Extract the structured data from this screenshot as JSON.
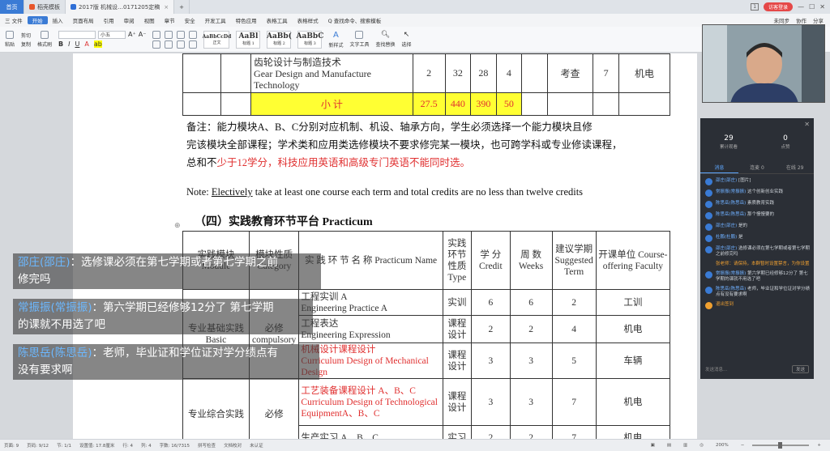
{
  "tabs": {
    "home": "首页",
    "t1": "稻壳模板",
    "t2": "2017版 机械设…0171205定稿",
    "right_login": "访客登录"
  },
  "menu": {
    "file": "三 文件",
    "items": [
      "开始",
      "插入",
      "页面布局",
      "引用",
      "审阅",
      "视图",
      "章节",
      "安全",
      "开发工具",
      "特色应用",
      "表格工具",
      "表格样式"
    ],
    "search": "Q 查找命令、搜索模板",
    "right": [
      "未同步",
      "协作",
      "分享"
    ]
  },
  "ribbon": {
    "paste": "粘贴",
    "cut": "剪切",
    "copy": "复制",
    "format_painter": "格式刷",
    "font_name": "",
    "font_size": "小五",
    "styles": [
      {
        "sample": "AaBbCcDd",
        "name": "正文"
      },
      {
        "sample": "AaBl",
        "name": "标题 1"
      },
      {
        "sample": "AaBb(",
        "name": "标题 2"
      },
      {
        "sample": "AaBbC",
        "name": "标题 3"
      }
    ],
    "new_style": "新样式",
    "text_tools": "文字工具",
    "find_replace": "查找替换",
    "select": "选择"
  },
  "table1": {
    "course_cn": "齿轮设计与制造技术",
    "course_en": "Gear Design and Manufacture Technology",
    "credit": "2",
    "hours": "32",
    "h1": "28",
    "h2": "4",
    "assess": "考查",
    "term": "7",
    "dept": "机电",
    "subtotal_label": "小 计",
    "sub_credit": "27.5",
    "sub_hours": "440",
    "sub_h1": "390",
    "sub_h2": "50"
  },
  "note": {
    "line1": "备注：能力模块A、B、C分别对应机制、机设、轴承方向，学生必须选择一个能力模块且修",
    "line2": "完该模块全部课程；学术类和应用类选修模块不要求修完某一模块，也可跨学科或专业修读课程，",
    "line3_black": "总和不",
    "line3_red": "少于12学分，科技应用英语和高级专门英语不能同时选。",
    "en_a": "Note: ",
    "en_u": "Electively",
    "en_b": " take at least one course each term and total credits are no less than twelve credits"
  },
  "section_title": "（四）实践教育环节平台  Practicum",
  "table2": {
    "headers": {
      "module": "实践模块 Module",
      "nature": "模块性质 Category",
      "name": "实 践 环 节 名 称 Practicum Name",
      "type": "实践环节性质 Type",
      "credit": "学 分 Credit",
      "weeks": "周 数 Weeks",
      "term": "建议学期 Suggested Term",
      "dept": "开课单位 Course-offering Faculty"
    },
    "basic_module": "专业基础实践 Basic",
    "basic_nature": "必修 compulsory",
    "rows": [
      {
        "name_cn": "工程实训 A",
        "name_en": "Engineering Practice A",
        "type": "实训",
        "credit": "6",
        "weeks": "6",
        "term": "2",
        "dept": "工训"
      },
      {
        "name_cn": "工程表达",
        "name_en": "Engineering Expression",
        "type": "课程设计",
        "credit": "2",
        "weeks": "2",
        "term": "4",
        "dept": "机电"
      },
      {
        "name_cn": "机械设计课程设计",
        "name_en": "Curriculum Design of Mechanical Design",
        "type": "课程设计",
        "credit": "3",
        "weeks": "3",
        "term": "5",
        "dept": "车辆"
      },
      {
        "name_cn": "工艺装备课程设计 A、B、C",
        "name_en": "Curriculum Design of Technological EquipmentA、B、C",
        "type": "课程设计",
        "credit": "3",
        "weeks": "3",
        "term": "7",
        "dept": "机电"
      },
      {
        "name_cn": "生产实习 A、B、C",
        "name_en": "",
        "type": "实习",
        "credit": "2",
        "weeks": "2",
        "term": "7",
        "dept": "机电"
      }
    ],
    "comp_module": "专业综合实践",
    "comp_nature": "必修"
  },
  "chat": {
    "count1": "29",
    "label1": "累计观看",
    "count2": "0",
    "label2": "点赞",
    "tabs": [
      "消息",
      "连麦 0",
      "在线 29"
    ],
    "messages": [
      {
        "name": "邵庄(邵庄)",
        "text": "[图片]"
      },
      {
        "name": "常振振(常振振)",
        "text": "这个创新创业实践"
      },
      {
        "name": "陈思岳(陈思岳)",
        "text": "素质教育实践"
      },
      {
        "name": "陈思岳(陈思岳)",
        "text": "那个慢慢要的"
      },
      {
        "name": "邵庄(邵庄)",
        "text": "是的"
      },
      {
        "name": "杜鹏(杜鹏)",
        "text": "是"
      },
      {
        "name": "邵庄(邵庄)",
        "text": "选修课必须在第七学期或者第七学期之前修完吗"
      },
      {
        "name": "常振振(常振振)",
        "text": "第六学期已经修够12分了 第七学期的课就不用选了吧"
      },
      {
        "name": "陈思岳(陈思岳)",
        "text": "老师，毕业证和学位证对学分绩点有没有要求啊"
      }
    ],
    "system": "张老师：请保持，本群暂时设置禁言，为你设置",
    "leave": "退出签到",
    "input_placeholder": "发送消息...",
    "send": "发送"
  },
  "danmu": [
    {
      "who": "邵庄(邵庄)",
      "text": "：选修课必须在第七学期或者第七学期之前",
      "text2": "修完吗"
    },
    {
      "who": "常振振(常振振)",
      "text": "：第六学期已经修够12分了 第七学期",
      "text2": "的课就不用选了吧"
    },
    {
      "who": "陈思岳(陈思岳)",
      "text": "：老师，毕业证和学位证对学分绩点有",
      "text2": "没有要求啊"
    }
  ],
  "status": {
    "items": [
      "页面: 9",
      "页码: 9/12",
      "节: 1/1",
      "设置值: 17.8厘米",
      "行: 4",
      "列: 4",
      "字数: 16/7315",
      "拼写检查",
      "文档校对",
      "未认证"
    ],
    "zoom": "200%"
  }
}
